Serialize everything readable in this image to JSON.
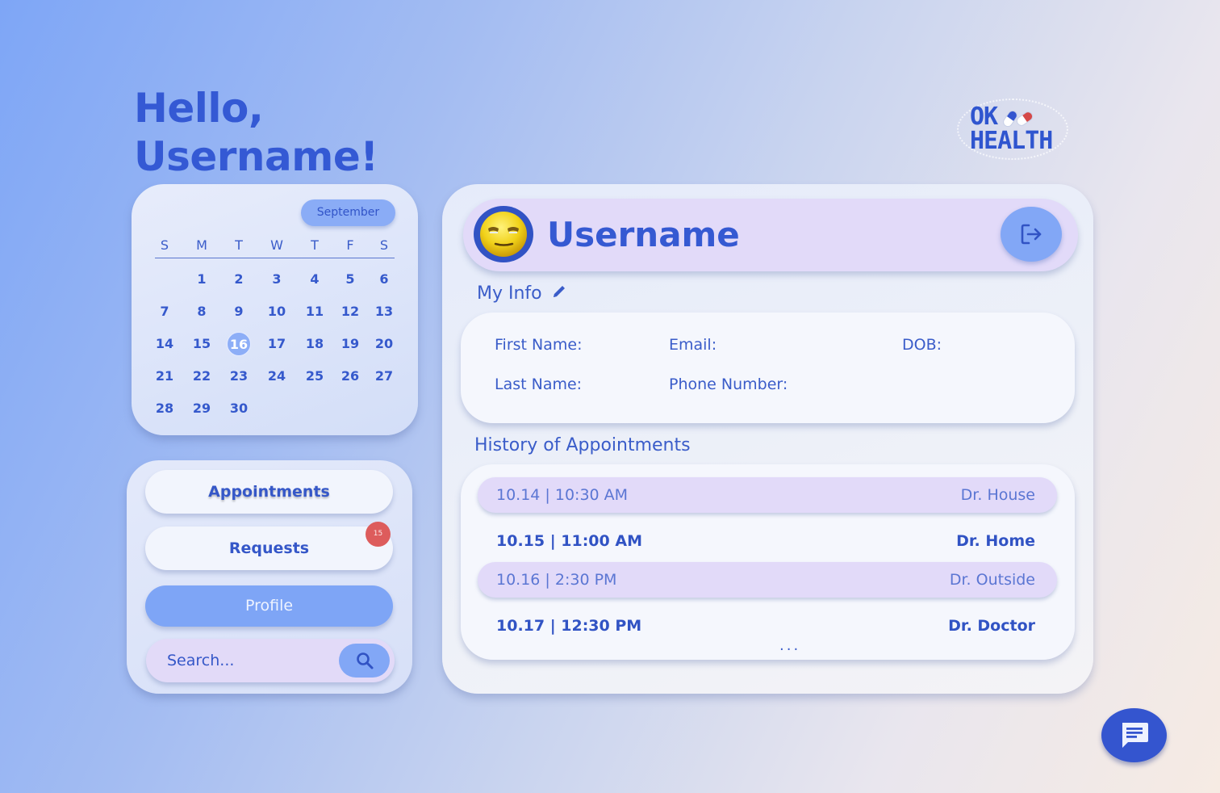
{
  "greeting": {
    "line1": "Hello,",
    "line2": "Username!"
  },
  "logo": {
    "line1": "OK",
    "line2": "HEALTH",
    "pill_colors": [
      "#d54848",
      "#3556cf"
    ]
  },
  "calendar": {
    "month": "September",
    "weekdays": [
      "S",
      "M",
      "T",
      "W",
      "T",
      "F",
      "S"
    ],
    "weeks": [
      [
        "",
        "1",
        "2",
        "3",
        "4",
        "5",
        "6"
      ],
      [
        "7",
        "8",
        "9",
        "10",
        "11",
        "12",
        "13"
      ],
      [
        "14",
        "15",
        "16",
        "17",
        "18",
        "19",
        "20"
      ],
      [
        "21",
        "22",
        "23",
        "24",
        "25",
        "26",
        "27"
      ],
      [
        "28",
        "29",
        "30",
        "",
        "",
        "",
        ""
      ]
    ],
    "selected_day": "16"
  },
  "nav": {
    "appointments": "Appointments",
    "requests": "Requests",
    "requests_badge": "15",
    "profile": "Profile",
    "active": "Profile",
    "search_placeholder": "Search..."
  },
  "profile": {
    "username": "Username",
    "my_info_title": "My Info",
    "fields": {
      "first_name": "First Name:",
      "email": "Email:",
      "dob": "DOB:",
      "last_name": "Last Name:",
      "phone": "Phone Number:"
    },
    "history_title": "History of Appointments",
    "appointments": [
      {
        "datetime": "10.14 | 10:30 AM",
        "doctor": "Dr. House"
      },
      {
        "datetime": "10.15 | 11:00 AM",
        "doctor": "Dr. Home"
      },
      {
        "datetime": "10.16 | 2:30 PM",
        "doctor": "Dr. Outside"
      },
      {
        "datetime": "10.17 | 12:30 PM",
        "doctor": "Dr. Doctor"
      }
    ],
    "more": "..."
  },
  "icons": {
    "edit": "pencil-icon",
    "logout": "logout-icon",
    "search": "search-icon",
    "chat": "chat-icon",
    "avatar": "emoji-face-icon"
  },
  "colors": {
    "accent": "#3459d4",
    "light_accent": "#82a7f6",
    "lavender": "#e2daf9",
    "badge": "#dd5c5c"
  }
}
